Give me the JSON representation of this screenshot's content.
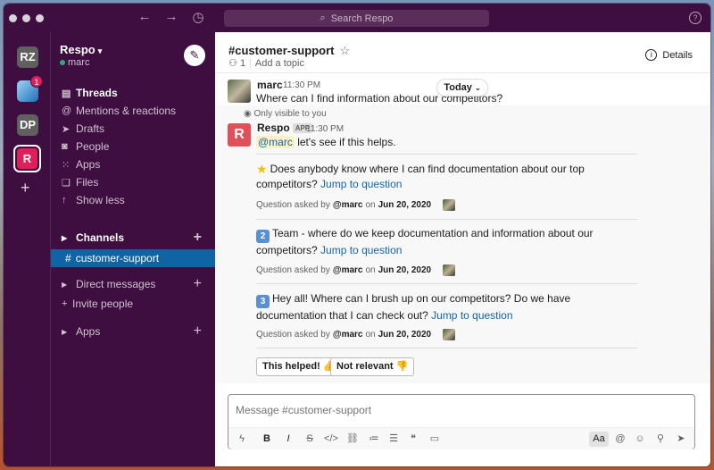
{
  "titlebar": {
    "search_placeholder": "Search Respo",
    "help_label": "?"
  },
  "rail": {
    "workspaces": [
      "RZ",
      "",
      "DP",
      "R"
    ],
    "badge_count": "1",
    "add_label": "+"
  },
  "sidebar": {
    "team_name": "Respo",
    "user_name": "marc",
    "items": [
      {
        "label": "Threads",
        "icon": "threads-icon"
      },
      {
        "label": "Mentions & reactions",
        "icon": "at-icon"
      },
      {
        "label": "Drafts",
        "icon": "drafts-icon"
      },
      {
        "label": "People",
        "icon": "people-icon"
      },
      {
        "label": "Apps",
        "icon": "apps-grid-icon"
      },
      {
        "label": "Files",
        "icon": "files-icon"
      },
      {
        "label": "Show less",
        "icon": "arrow-up-icon"
      }
    ],
    "channels_label": "Channels",
    "active_channel": "customer-support",
    "dm_label": "Direct messages",
    "invite_label": "Invite people",
    "apps_label": "Apps"
  },
  "channel": {
    "name": "#customer-support",
    "member_count": "1",
    "add_topic": "Add a topic",
    "details_label": "Details"
  },
  "messages": {
    "today_label": "Today",
    "first": {
      "sender": "marc",
      "time": "11:30 PM",
      "text": "Where can I find information about our competitors?"
    },
    "only_visible": "Only visible to you",
    "bot": {
      "sender": "Respo",
      "app_tag": "APP",
      "time": "11:30 PM",
      "mention": "@marc",
      "text": "let's see if this helps."
    },
    "questions": [
      {
        "text": "Does anybody know where I can find documentation about our top competitors?",
        "link": "Jump to question",
        "meta_prefix": "Question asked by",
        "asker": "@marc",
        "meta_on": "on",
        "date": "Jun 20, 2020"
      },
      {
        "text": "Team - where do we keep documentation and information about our competitors?",
        "link": "Jump to question",
        "meta_prefix": "Question asked by",
        "asker": "@marc",
        "meta_on": "on",
        "date": "Jun 20, 2020"
      },
      {
        "text": "Hey all! Where can I brush up on our competitors? Do we have documentation that I can check out?",
        "link": "Jump to question",
        "meta_prefix": "Question asked by",
        "asker": "@marc",
        "meta_on": "on",
        "date": "Jun 20, 2020"
      }
    ],
    "buttons": {
      "helped": "This helped! 👍",
      "not_relevant": "Not relevant 👎"
    }
  },
  "composer": {
    "placeholder": "Message #customer-support",
    "format_label": "Aa"
  },
  "colors": {
    "sidebar_bg": "#3f0e40",
    "active_channel": "#1164a3",
    "link": "#1264a3",
    "brand_red": "#e01e5a"
  }
}
